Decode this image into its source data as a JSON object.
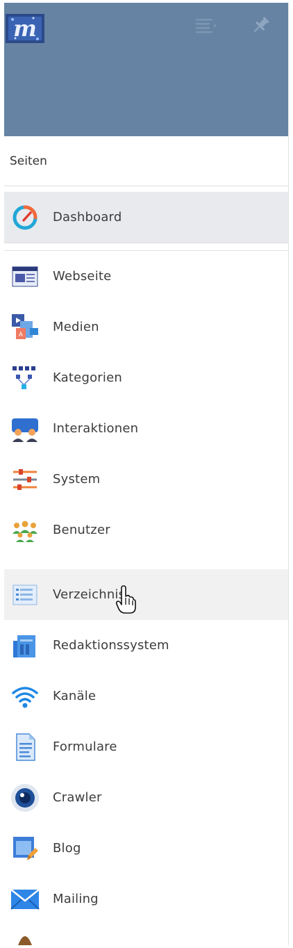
{
  "header": {
    "logo_alt": "m",
    "menu_icon": "list-collapse-icon",
    "pin_icon": "pin-icon"
  },
  "section": {
    "title": "Seiten"
  },
  "nav": [
    {
      "label": "Dashboard",
      "icon": "dashboard-gauge-icon",
      "state": "active"
    },
    {
      "label": "Webseite",
      "icon": "webpage-icon"
    },
    {
      "label": "Medien",
      "icon": "media-icon"
    },
    {
      "label": "Kategorien",
      "icon": "categories-icon"
    },
    {
      "label": "Interaktionen",
      "icon": "interactions-icon"
    },
    {
      "label": "System",
      "icon": "system-sliders-icon"
    },
    {
      "label": "Benutzer",
      "icon": "users-icon"
    },
    {
      "label": "Verzeichnis",
      "icon": "directory-icon",
      "state": "hover"
    },
    {
      "label": "Redaktionssystem",
      "icon": "cms-icon"
    },
    {
      "label": "Kanäle",
      "icon": "wifi-channels-icon"
    },
    {
      "label": "Formulare",
      "icon": "forms-icon"
    },
    {
      "label": "Crawler",
      "icon": "crawler-eye-icon"
    },
    {
      "label": "Blog",
      "icon": "blog-pen-icon"
    },
    {
      "label": "Mailing",
      "icon": "mail-envelope-icon"
    }
  ],
  "colors": {
    "header_bg": "#6683a3",
    "active_bg": "#e8eaee",
    "hover_bg": "#f1f1f1"
  }
}
